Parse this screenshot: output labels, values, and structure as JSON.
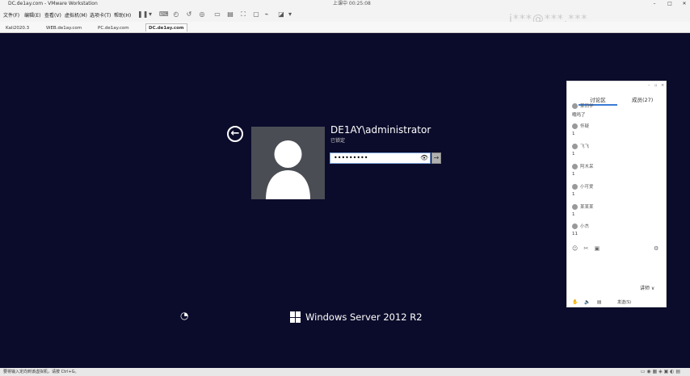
{
  "window": {
    "title": "DC.de1ay.com - VMware Workstation",
    "recording": "上课中 00:25:08"
  },
  "menu": {
    "items": [
      "文件(F)",
      "编辑(E)",
      "查看(V)",
      "虚拟机(M)",
      "选项卡(T)",
      "帮助(H)"
    ]
  },
  "tabs": [
    {
      "label": "Kali2020.3"
    },
    {
      "label": "WEB.de1ay.com"
    },
    {
      "label": "PC.de1ay.com"
    },
    {
      "label": "DC.de1ay.com"
    }
  ],
  "watermark": "i***@***.***",
  "login": {
    "username": "DE1AY\\administrator",
    "status": "已锁定",
    "password_mask": "•••••••••",
    "submit_glyph": "→"
  },
  "footer": {
    "brand": "Windows Server 2012 R2"
  },
  "chat": {
    "tab_discussion": "讨论区",
    "tab_members": "成员(27)",
    "messages": [
      {
        "user": "某同学",
        "text": "哦吗了"
      },
      {
        "user": "怀疑",
        "text": "1"
      },
      {
        "user": "飞飞",
        "text": "1"
      },
      {
        "user": "阿木呆",
        "text": "1"
      },
      {
        "user": "小可爱",
        "text": "1"
      },
      {
        "user": "某某某",
        "text": "1"
      },
      {
        "user": "小杰",
        "text": "11"
      }
    ],
    "send_mode": "讲师 ∨",
    "send_label": "发送(S)"
  },
  "statusbar": {
    "hint": "要将输入定向到该虚拟机，请按 Ctrl+G。"
  },
  "colors": {
    "desktop": "#0b0b2b",
    "accent": "#3a7bd5"
  }
}
